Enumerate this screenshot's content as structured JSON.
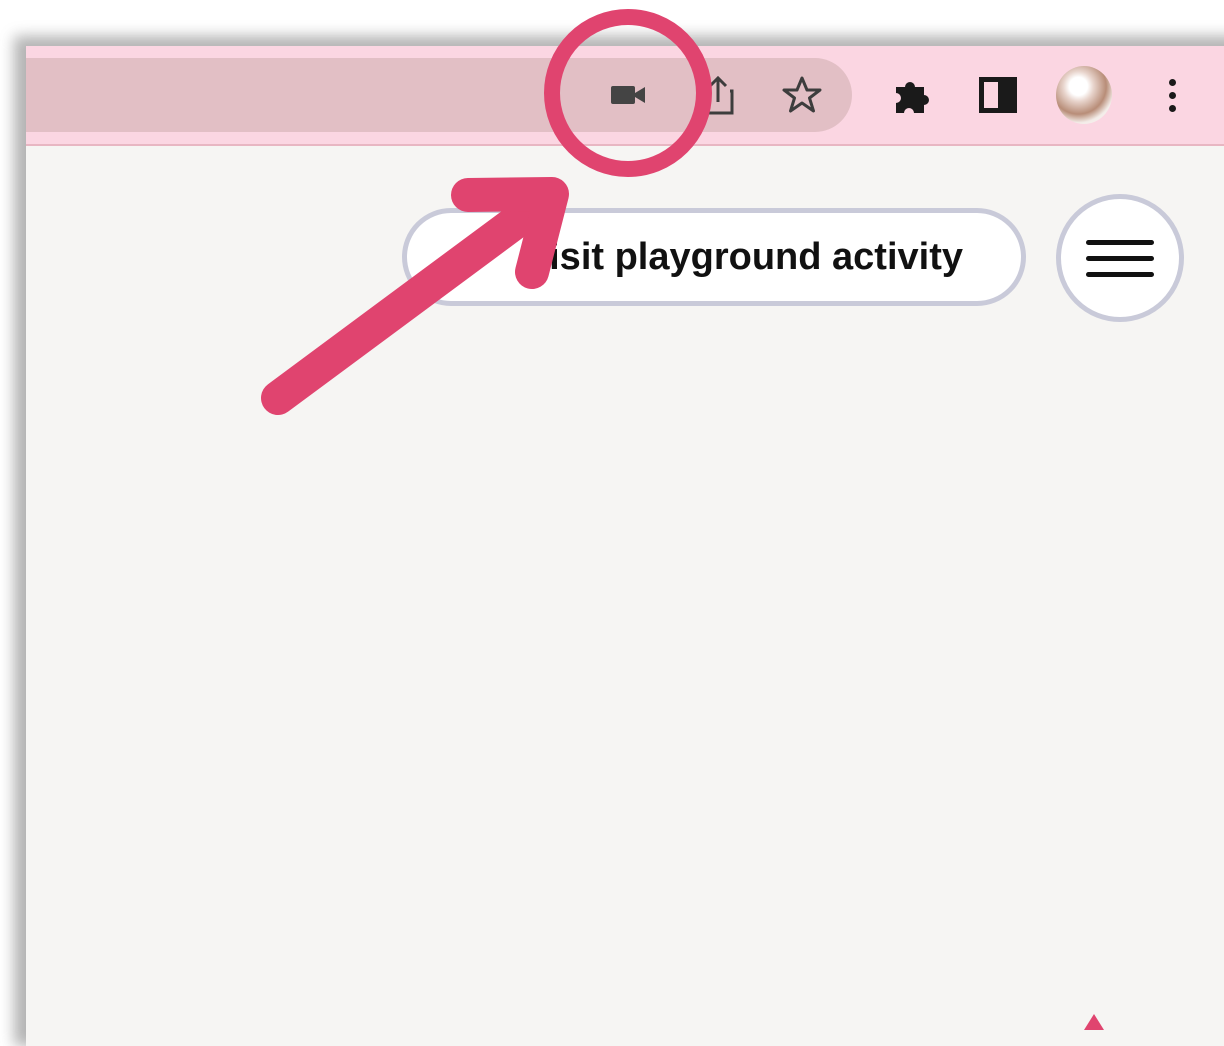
{
  "browser": {
    "omnibox_icons": [
      "video-camera-icon",
      "share-icon",
      "star-icon"
    ],
    "toolbar_icons": [
      "puzzle-icon",
      "side-panel-icon",
      "avatar",
      "more-icon"
    ]
  },
  "page": {
    "pill_button_label": "Visit playground activity",
    "menu_icon": "hamburger-icon"
  },
  "colors": {
    "toolbar_bg": "#fbd6e2",
    "omnibox_bg": "#e2bfc5",
    "page_bg": "#f6f5f3",
    "annotation": "#e0446f",
    "button_border": "#c9cad9"
  }
}
